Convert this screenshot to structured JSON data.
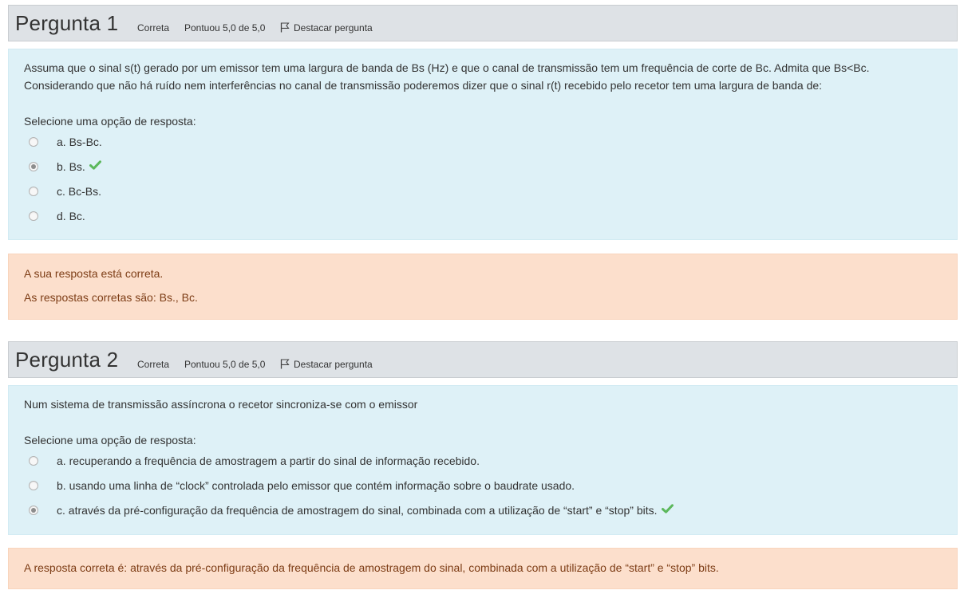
{
  "questions": [
    {
      "title_word": "Pergunta",
      "number": "1",
      "status": "Correta",
      "score": "Pontuou 5,0 de 5,0",
      "flag_label": "Destacar pergunta",
      "text_line1": "Assuma que o sinal s(t) gerado por um emissor tem uma largura de banda de Bs (Hz) e que o canal de transmissão tem um frequência de corte de Bc. Admita que Bs<Bc.",
      "text_line2": "Considerando que não há ruído nem interferências no canal de transmissão poderemos dizer que o sinal  r(t) recebido pelo recetor tem uma largura de banda de:",
      "prompt": "Selecione uma opção de resposta:",
      "options": [
        {
          "label": "a. Bs-Bc.",
          "selected": false,
          "correct": false
        },
        {
          "label": "b. Bs.",
          "selected": true,
          "correct": true
        },
        {
          "label": "c. Bc-Bs.",
          "selected": false,
          "correct": false
        },
        {
          "label": "d. Bc.",
          "selected": false,
          "correct": false
        }
      ],
      "feedback_line1": "A sua resposta está correta.",
      "feedback_line2": "As respostas corretas são: Bs., Bc."
    },
    {
      "title_word": "Pergunta",
      "number": "2",
      "status": "Correta",
      "score": "Pontuou 5,0 de 5,0",
      "flag_label": "Destacar pergunta",
      "text_line1": "Num sistema de transmissão assíncrona o recetor sincroniza-se com o emissor",
      "prompt": "Selecione uma opção de resposta:",
      "options": [
        {
          "label": "a. recuperando a frequência de amostragem a partir do sinal de informação recebido.",
          "selected": false,
          "correct": false
        },
        {
          "label": "b. usando uma linha de “clock” controlada pelo emissor que contém informação sobre o baudrate usado.",
          "selected": false,
          "correct": false
        },
        {
          "label": "c. através da pré-configuração da frequência de amostragem do sinal, combinada com a utilização de “start” e “stop” bits.",
          "selected": true,
          "correct": true
        }
      ],
      "feedback_line1": "A resposta correta é: através da pré-configuração da frequência de amostragem do sinal, combinada com a utilização de “start” e “stop” bits."
    }
  ],
  "icons": {
    "flag": "flag-icon",
    "correct": "check-icon"
  },
  "colors": {
    "header_bg": "#dee2e6",
    "question_bg": "#def1f7",
    "feedback_bg": "#fcdfcc",
    "feedback_text": "#7d3d16",
    "check": "#5cb85c"
  }
}
